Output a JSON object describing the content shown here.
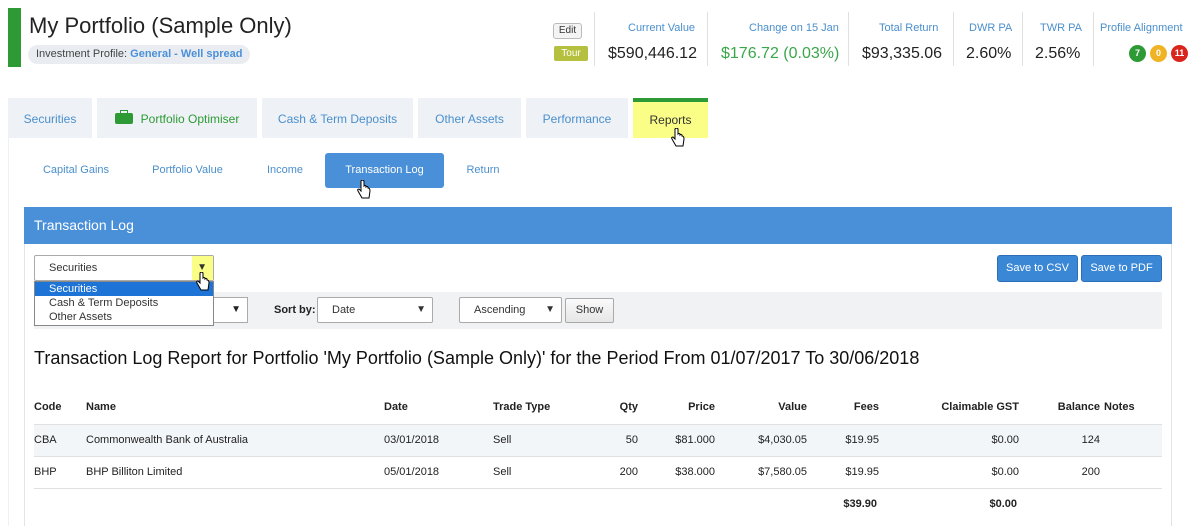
{
  "header": {
    "title": "My Portfolio (Sample Only)",
    "profile_label": "Investment Profile:",
    "profile_value": "General - Well spread",
    "edit_label": "Edit",
    "tour_label": "Tour",
    "stats": [
      {
        "label": "Current Value",
        "value": "$590,446.12"
      },
      {
        "label": "Change on 15 Jan",
        "value": "$176.72 (0.03%)"
      },
      {
        "label": "Total Return",
        "value": "$93,335.06"
      },
      {
        "label": "DWR PA",
        "value": "2.60%"
      },
      {
        "label": "TWR PA",
        "value": "2.56%"
      }
    ],
    "alignment": {
      "label": "Profile Alignment",
      "dots": [
        {
          "value": "7",
          "color": "#2e9a35"
        },
        {
          "value": "0",
          "color": "#f0b323"
        },
        {
          "value": "11",
          "color": "#d9261c"
        }
      ]
    }
  },
  "main_tabs": [
    {
      "label": "Securities"
    },
    {
      "label": "Portfolio Optimiser"
    },
    {
      "label": "Cash & Term Deposits"
    },
    {
      "label": "Other Assets"
    },
    {
      "label": "Performance"
    },
    {
      "label": "Reports",
      "active": true
    }
  ],
  "sub_tabs": [
    {
      "label": "Capital Gains"
    },
    {
      "label": "Portfolio Value"
    },
    {
      "label": "Income"
    },
    {
      "label": "Transaction Log",
      "active": true
    },
    {
      "label": "Return"
    }
  ],
  "section": {
    "title": "Transaction Log",
    "asset_select": {
      "value": "Securities",
      "options": [
        "Securities",
        "Cash & Term Deposits",
        "Other Assets"
      ]
    },
    "save_csv": "Save to CSV",
    "save_pdf": "Save to PDF",
    "sort_by_label": "Sort by:",
    "sort_value": "Date",
    "order_value": "Ascending",
    "show_label": "Show",
    "report_title": "Transaction Log Report for Portfolio 'My Portfolio (Sample Only)' for the Period From 01/07/2017 To 30/06/2018"
  },
  "table": {
    "headers": [
      "Code",
      "Name",
      "Date",
      "Trade Type",
      "Qty",
      "Price",
      "Value",
      "Fees",
      "Claimable GST",
      "Balance",
      "Notes"
    ],
    "rows": [
      [
        "CBA",
        "Commonwealth Bank of Australia",
        "03/01/2018",
        "Sell",
        "50",
        "$81.000",
        "$4,030.05",
        "$19.95",
        "$0.00",
        "124",
        ""
      ],
      [
        "BHP",
        "BHP Billiton Limited",
        "05/01/2018",
        "Sell",
        "200",
        "$38.000",
        "$7,580.05",
        "$19.95",
        "$0.00",
        "200",
        ""
      ]
    ],
    "totals": {
      "fees": "$39.90",
      "gst": "$0.00"
    }
  }
}
